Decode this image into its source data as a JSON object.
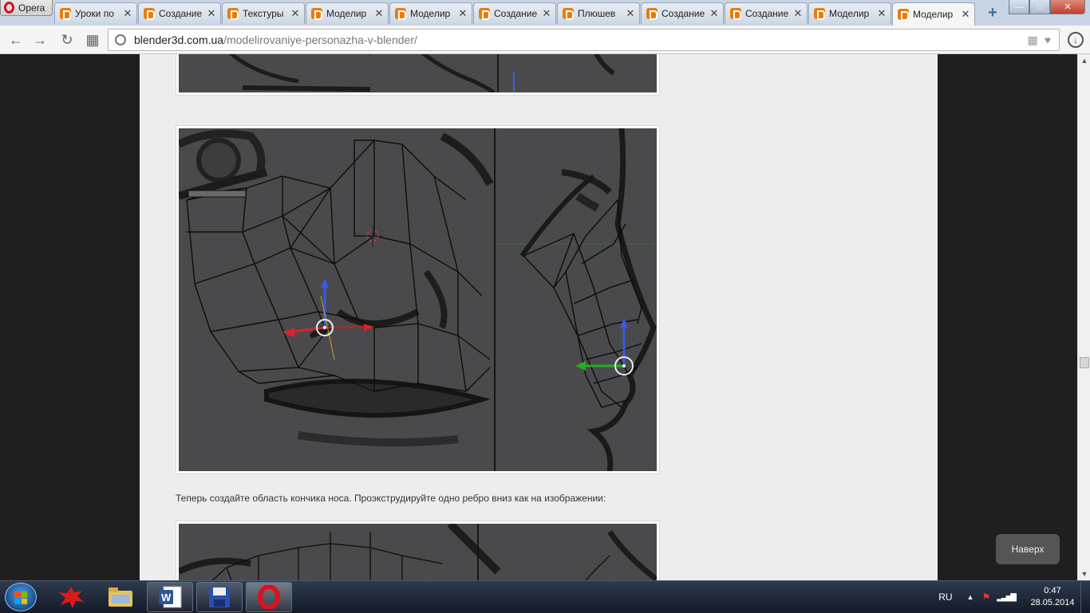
{
  "browser": {
    "menu_label": "Opera",
    "tabs": [
      {
        "title": "Уроки по"
      },
      {
        "title": "Создание"
      },
      {
        "title": "Текстуры"
      },
      {
        "title": "Моделир"
      },
      {
        "title": "Моделир"
      },
      {
        "title": "Создание"
      },
      {
        "title": "Плюшев"
      },
      {
        "title": "Создание"
      },
      {
        "title": "Создание"
      },
      {
        "title": "Моделир"
      },
      {
        "title": "Моделир",
        "active": true
      }
    ],
    "url_host": "blender3d.com.ua",
    "url_path": "/modelirovaniye-personazha-v-blender/"
  },
  "article": {
    "paragraph": "Теперь создайте область кончика носа. Проэкструдируйте одно ребро вниз как на изображении:"
  },
  "to_top_label": "Наверх",
  "taskbar": {
    "language": "RU",
    "time": "0:47",
    "date": "28.05.2014"
  },
  "colors": {
    "viewport_bg": "#4a4a4d",
    "accent_opera": "#d31020",
    "favicon": "#e87d0d"
  }
}
